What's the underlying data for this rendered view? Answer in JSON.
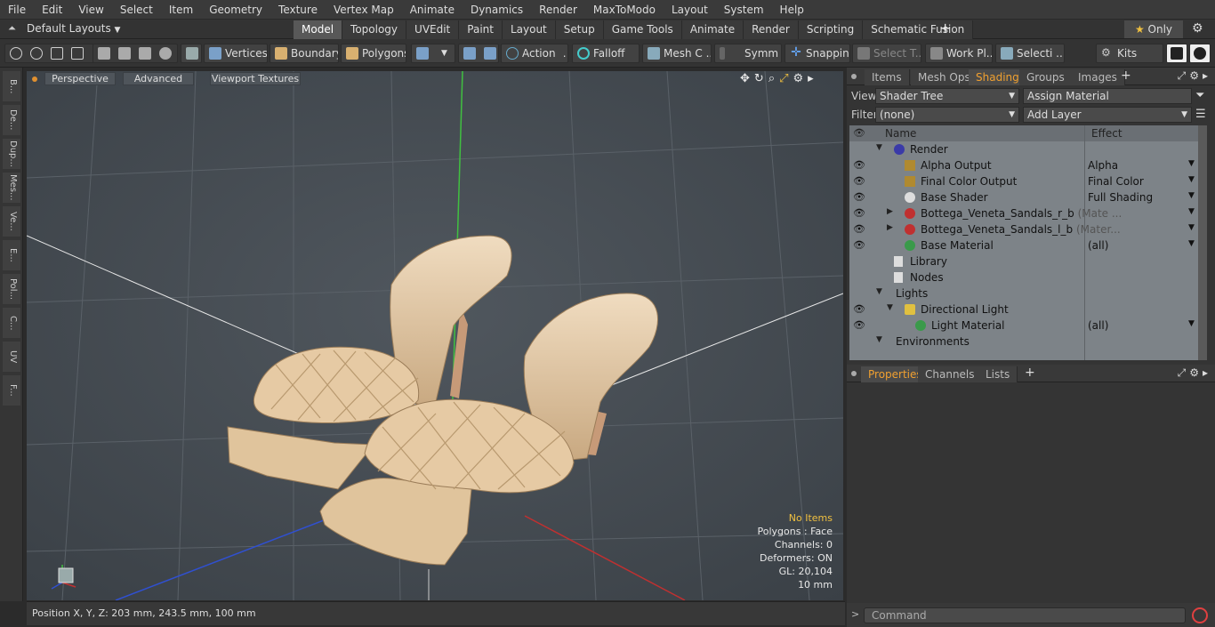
{
  "menubar": [
    "File",
    "Edit",
    "View",
    "Select",
    "Item",
    "Geometry",
    "Texture",
    "Vertex Map",
    "Animate",
    "Dynamics",
    "Render",
    "MaxToModo",
    "Layout",
    "System",
    "Help"
  ],
  "layouts": {
    "label": "Default Layouts"
  },
  "tabs": [
    "Model",
    "Topology",
    "UVEdit",
    "Paint",
    "Layout",
    "Setup",
    "Game Tools",
    "Animate",
    "Render",
    "Scripting",
    "Schematic Fusion"
  ],
  "active_tab": "Model",
  "only_label": "Only",
  "toolbar": {
    "vertices": "Vertices",
    "boundary": "Boundary",
    "polygons": "Polygons",
    "action": "Action",
    "falloff": "Falloff",
    "meshc": "Mesh C ...",
    "symm": "Symm ...",
    "snapping": "Snapping",
    "selectt": "Select T...",
    "workpl": "Work Pl...",
    "selecti": "Selecti ...",
    "kits": "Kits"
  },
  "leftstrip": [
    "B...",
    "De...",
    "Dup...",
    "Mes...",
    "Ve...",
    "E...",
    "Pol...",
    "C...",
    "UV",
    "F..."
  ],
  "viewport": {
    "perspective": "Perspective",
    "advanced": "Advanced",
    "textures": "Viewport Textures",
    "info": {
      "no_items": "No Items",
      "polygons": "Polygons : Face",
      "channels": "Channels: 0",
      "deformers": "Deformers: ON",
      "gl": "GL: 20,104",
      "unit": "10 mm"
    }
  },
  "status": {
    "position": "Position X, Y, Z:  203 mm, 243.5 mm, 100 mm"
  },
  "right_tabs": [
    "Items",
    "Mesh Ops",
    "Shading",
    "Groups",
    "Images"
  ],
  "right_active": "Shading",
  "view": {
    "label": "View",
    "value": "Shader Tree",
    "assign": "Assign Material"
  },
  "filter": {
    "label": "Filter",
    "value": "(none)",
    "add_layer": "Add Layer"
  },
  "tree": {
    "col_name": "Name",
    "col_effect": "Effect",
    "rows": [
      {
        "name": "Render",
        "sub": "",
        "effect": ""
      },
      {
        "name": "Alpha Output",
        "sub": "",
        "effect": "Alpha"
      },
      {
        "name": "Final Color Output",
        "sub": "",
        "effect": "Final Color"
      },
      {
        "name": "Base Shader",
        "sub": "",
        "effect": "Full Shading"
      },
      {
        "name": "Bottega_Veneta_Sandals_r_b",
        "sub": "(Mate ...",
        "effect": ""
      },
      {
        "name": "Bottega_Veneta_Sandals_l_b",
        "sub": "(Mater...",
        "effect": ""
      },
      {
        "name": "Base Material",
        "sub": "",
        "effect": "(all)"
      },
      {
        "name": "Library",
        "sub": "",
        "effect": ""
      },
      {
        "name": "Nodes",
        "sub": "",
        "effect": ""
      },
      {
        "name": "Lights",
        "sub": "",
        "effect": ""
      },
      {
        "name": "Directional Light",
        "sub": "",
        "effect": ""
      },
      {
        "name": "Light Material",
        "sub": "",
        "effect": "(all)"
      },
      {
        "name": "Environments",
        "sub": "",
        "effect": ""
      }
    ]
  },
  "props_tabs": [
    "Properties",
    "Channels",
    "Lists"
  ],
  "props_active": "Properties",
  "command": {
    "placeholder": "Command"
  },
  "colors": {
    "accent": "#f0a030",
    "viewport": "#464c52",
    "shoe": "#e2c7a2"
  }
}
